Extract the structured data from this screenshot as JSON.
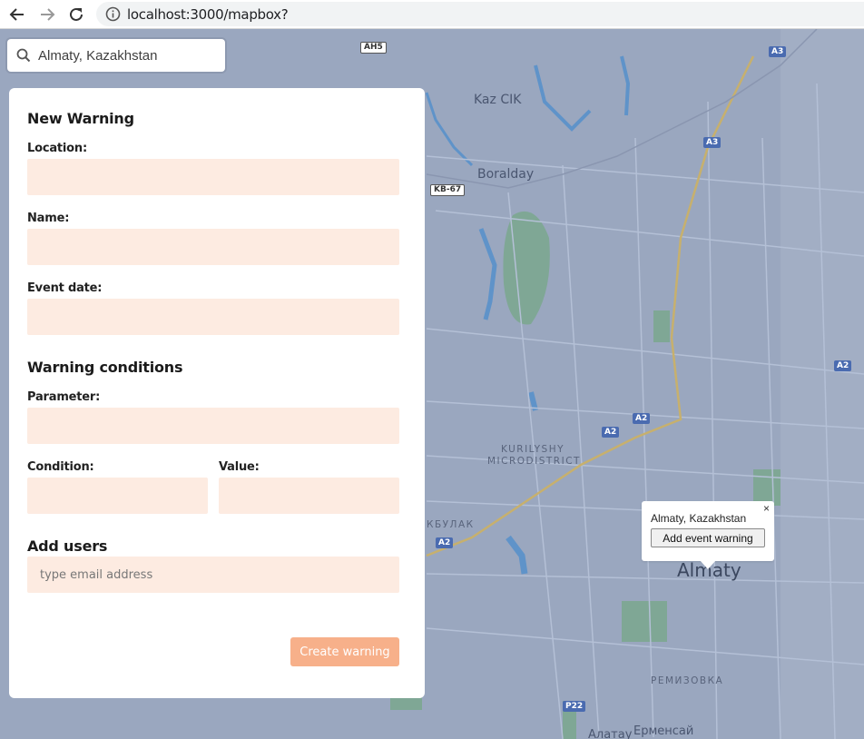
{
  "browser": {
    "url": "localhost:3000/mapbox?"
  },
  "search": {
    "value": "Almaty, Kazakhstan"
  },
  "form": {
    "title": "New Warning",
    "location_label": "Location:",
    "name_label": "Name:",
    "event_date_label": "Event date:",
    "conditions_title": "Warning conditions",
    "parameter_label": "Parameter:",
    "condition_label": "Condition:",
    "value_label": "Value:",
    "users_title": "Add users",
    "email_placeholder": "type email address",
    "create_button": "Create warning"
  },
  "popup": {
    "title": "Almaty, Kazakhstan",
    "button": "Add event warning",
    "close": "×"
  },
  "map": {
    "labels": {
      "kaz_cik": "Kaz CIK",
      "boralday": "Boralday",
      "kurilyshy_1": "KURILYSHY",
      "kurilyshy_2": "MICRODISTRICT",
      "kbulak": "КБУЛАК",
      "almaty": "Almaty",
      "remizovka": "РЕМИЗОВКА",
      "ermensai": "Ерменсай",
      "almatau": "Алатау"
    },
    "shields": {
      "ah5": "AH5",
      "a3_top": "A3",
      "a3_mid": "A3",
      "kb67": "KB-67",
      "a2_right": "A2",
      "a2_center": "A2",
      "a2_mid": "A2",
      "a2_left": "A2",
      "p22": "P22"
    },
    "colors": {
      "background": "#9aa7bf",
      "water": "#5f93c9",
      "park": "#7fa795",
      "road": "#b4c0d6",
      "highway": "#c7b06d"
    }
  }
}
